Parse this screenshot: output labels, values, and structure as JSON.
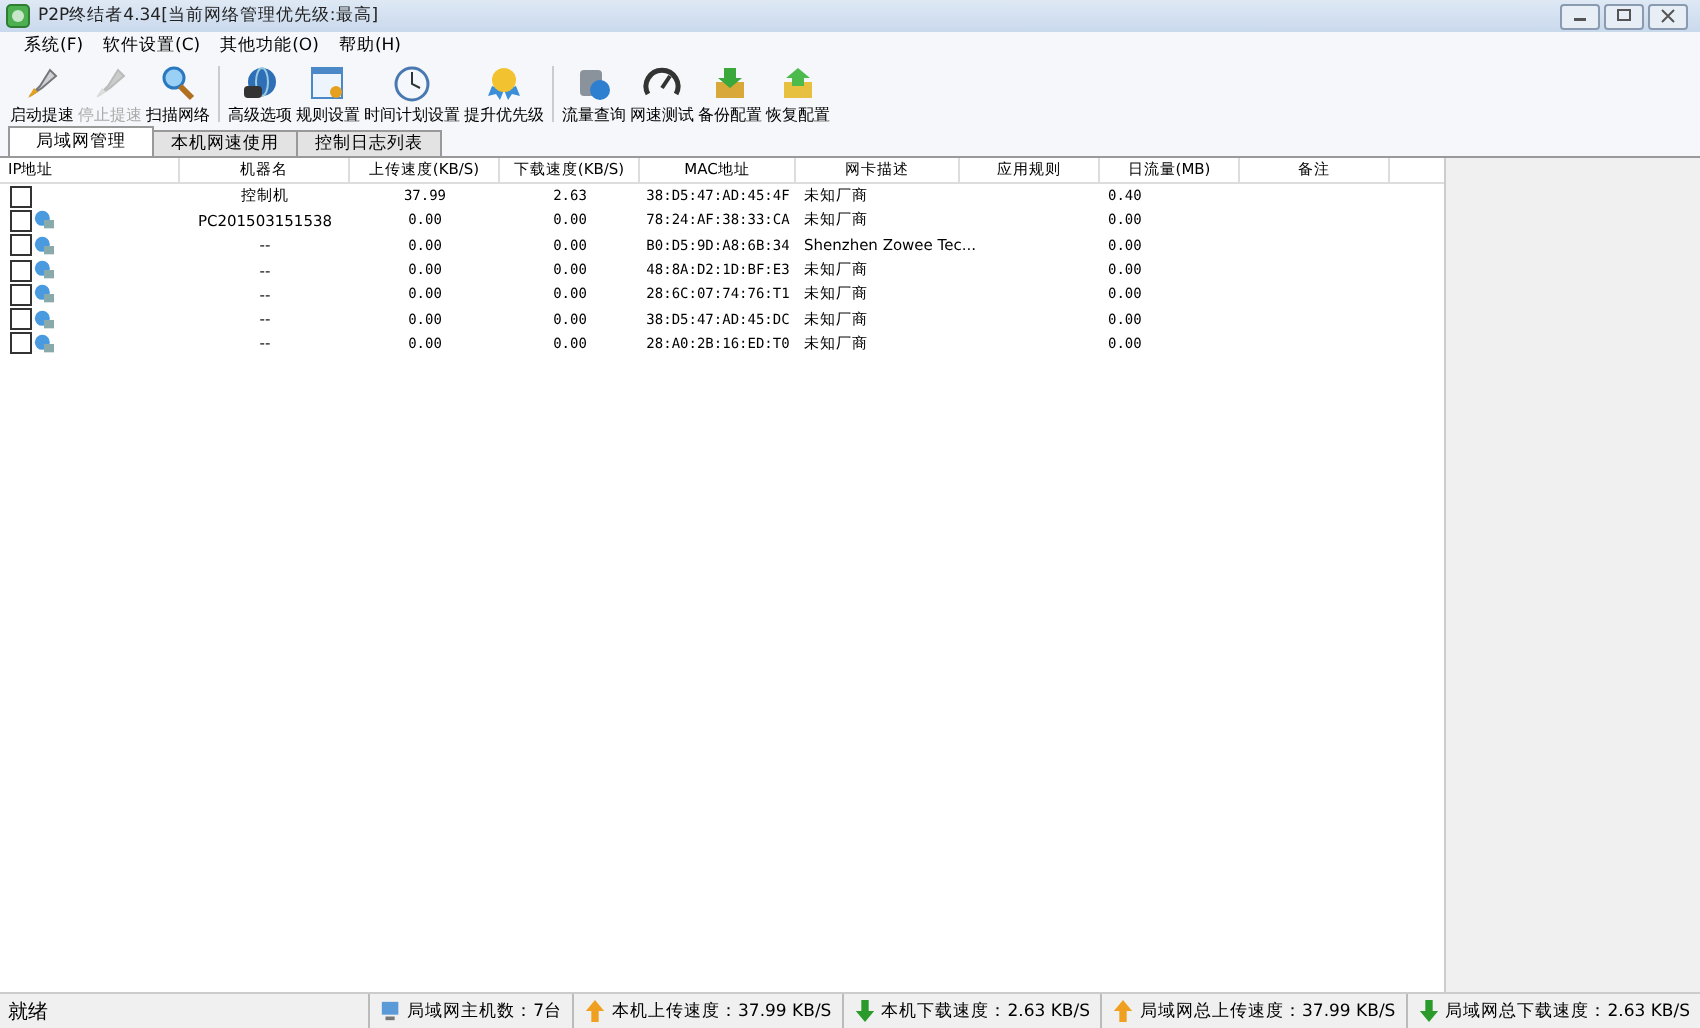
{
  "window": {
    "title": "P2P终结者4.34[当前网络管理优先级:最高]"
  },
  "menu": [
    "系统(F)",
    "软件设置(C)",
    "其他功能(O)",
    "帮助(H)"
  ],
  "toolbar": [
    {
      "label": "启动提速",
      "kind": "rocket",
      "disabled": false,
      "sep": false
    },
    {
      "label": "停止提速",
      "kind": "rocket",
      "disabled": true,
      "sep": false
    },
    {
      "label": "扫描网络",
      "kind": "search",
      "disabled": false,
      "sep": false
    },
    {
      "label": "高级选项",
      "kind": "globe",
      "disabled": false,
      "sep": true
    },
    {
      "label": "规则设置",
      "kind": "window",
      "disabled": false,
      "sep": false
    },
    {
      "label": "时间计划设置",
      "kind": "clock",
      "disabled": false,
      "sep": false
    },
    {
      "label": "提升优先级",
      "kind": "medal",
      "disabled": false,
      "sep": false
    },
    {
      "label": "流量查询",
      "kind": "database",
      "disabled": false,
      "sep": true
    },
    {
      "label": "网速测试",
      "kind": "gauge",
      "disabled": false,
      "sep": false
    },
    {
      "label": "备份配置",
      "kind": "boxdown",
      "disabled": false,
      "sep": false
    },
    {
      "label": "恢复配置",
      "kind": "boxup",
      "disabled": false,
      "sep": false
    }
  ],
  "tabs": [
    {
      "label": "局域网管理",
      "selected": true
    },
    {
      "label": "本机网速使用",
      "selected": false
    },
    {
      "label": "控制日志列表",
      "selected": false
    }
  ],
  "table": {
    "columns": [
      "IP地址",
      "机器名",
      "上传速度(KB/S)",
      "下载速度(KB/S)",
      "MAC地址",
      "网卡描述",
      "应用规则",
      "日流量(MB)",
      "备注"
    ],
    "rows": [
      {
        "kind": "local",
        "checked": false,
        "name": "控制机",
        "up": "37.99",
        "down": "2.63",
        "mac": "38:D5:47:AD:45:4F",
        "desc": "未知厂商",
        "daily": "0.40"
      },
      {
        "kind": "host",
        "checked": false,
        "name": "PC201503151538",
        "up": "0.00",
        "down": "0.00",
        "mac": "78:24:AF:38:33:CA",
        "desc": "未知厂商",
        "daily": "0.00"
      },
      {
        "kind": "host",
        "checked": false,
        "name": "--",
        "up": "0.00",
        "down": "0.00",
        "mac": "B0:D5:9D:A8:6B:34",
        "desc": "Shenzhen Zowee Tec...",
        "daily": "0.00"
      },
      {
        "kind": "host",
        "checked": false,
        "name": "--",
        "up": "0.00",
        "down": "0.00",
        "mac": "48:8A:D2:1D:BF:E3",
        "desc": "未知厂商",
        "daily": "0.00"
      },
      {
        "kind": "host",
        "checked": false,
        "name": "--",
        "up": "0.00",
        "down": "0.00",
        "mac": "28:6C:07:74:76:T1",
        "desc": "未知厂商",
        "daily": "0.00"
      },
      {
        "kind": "host",
        "checked": false,
        "name": "--",
        "up": "0.00",
        "down": "0.00",
        "mac": "38:D5:47:AD:45:DC",
        "desc": "未知厂商",
        "daily": "0.00"
      },
      {
        "kind": "host",
        "checked": false,
        "name": "--",
        "up": "0.00",
        "down": "0.00",
        "mac": "28:A0:2B:16:ED:T0",
        "desc": "未知厂商",
        "daily": "0.00"
      }
    ]
  },
  "status_bar": {
    "text": "就绪",
    "segments": [
      {
        "kind": "hosts",
        "text": "局域网主机数：7台"
      },
      {
        "kind": "up",
        "text": "本机上传速度：37.99 KB/S"
      },
      {
        "kind": "down",
        "text": "本机下载速度：2.63 KB/S"
      },
      {
        "kind": "up",
        "text": "局域网总上传速度：37.99 KB/S"
      },
      {
        "kind": "down",
        "text": "局域网总下载速度：2.63 KB/S"
      }
    ]
  }
}
